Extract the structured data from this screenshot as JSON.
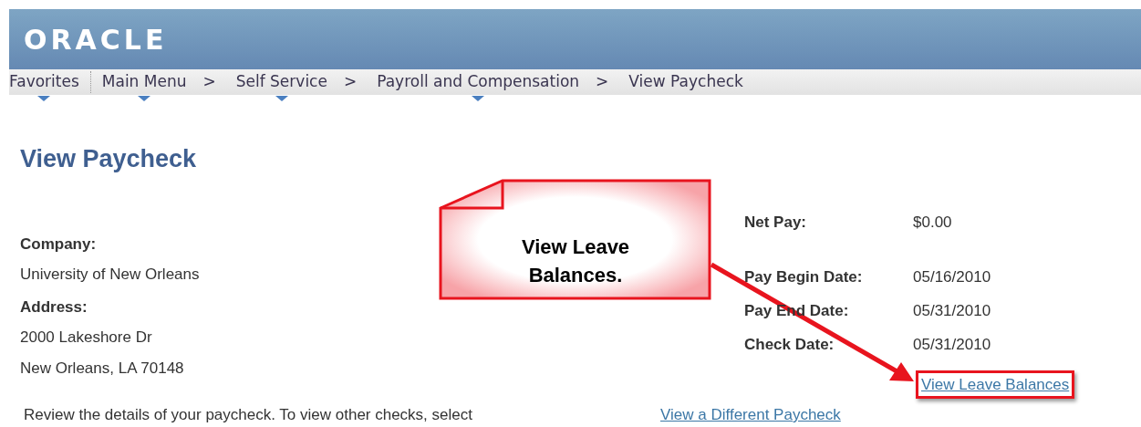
{
  "header": {
    "logo": "ORACLE"
  },
  "breadcrumbs": [
    {
      "kind": "menu",
      "label": "Favorites"
    },
    {
      "kind": "divider"
    },
    {
      "kind": "menu",
      "label": "Main Menu"
    },
    {
      "kind": "separator",
      "label": ">"
    },
    {
      "kind": "menu",
      "label": "Self Service"
    },
    {
      "kind": "separator",
      "label": ">"
    },
    {
      "kind": "menu",
      "label": "Payroll and Compensation"
    },
    {
      "kind": "separator",
      "label": ">"
    },
    {
      "kind": "page",
      "label": "View Paycheck"
    }
  ],
  "page_title": "View Paycheck",
  "company": {
    "label": "Company:",
    "value": "University of New Orleans"
  },
  "address": {
    "label": "Address:",
    "lines": [
      "2000 Lakeshore Dr",
      "New Orleans, LA 70148"
    ]
  },
  "summary": [
    {
      "label": "Net Pay:",
      "value": "$0.00"
    },
    {
      "label": "Pay Begin Date:",
      "value": "05/16/2010"
    },
    {
      "label": "Pay End Date:",
      "value": "05/31/2010"
    },
    {
      "label": "Check Date:",
      "value": "05/31/2010"
    }
  ],
  "leave_link": "View Leave Balances",
  "instructions": "Review the details of your paycheck.  To view other checks, select",
  "different_link": "View a Different Paycheck",
  "callout": {
    "text": "View Leave Balances."
  }
}
